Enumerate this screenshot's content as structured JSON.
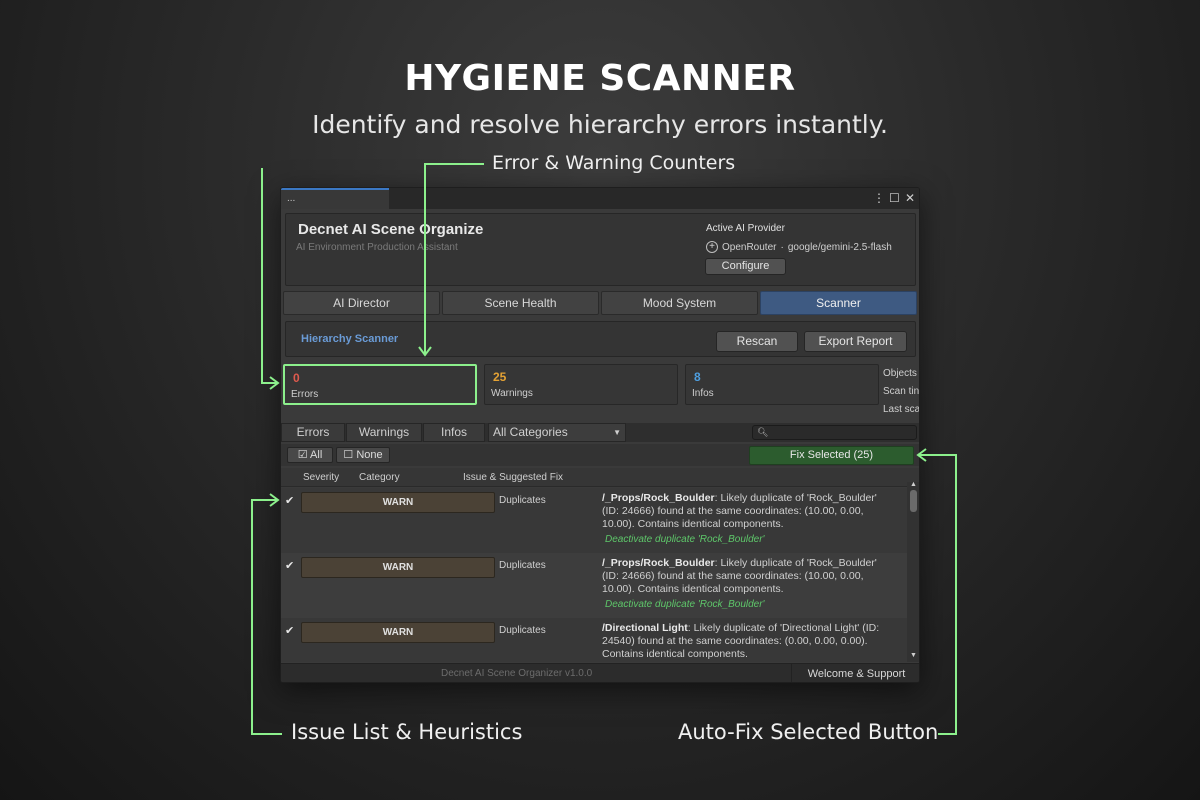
{
  "hero": {
    "title": "HYGIENE SCANNER",
    "subtitle": "Identify and resolve hierarchy errors instantly."
  },
  "callouts": {
    "top": "Error & Warning Counters",
    "bottom_left": "Issue List & Heuristics",
    "bottom_right": "Auto-Fix Selected Button"
  },
  "window": {
    "tab_label": "...",
    "controls": [
      "more-icon",
      "maximize-icon",
      "close-icon"
    ],
    "app_title": "Decnet AI Scene Organize",
    "app_subtitle": "AI Environment Production Assistant",
    "provider_title": "Active AI Provider",
    "provider_name": "OpenRouter",
    "provider_sep": "·",
    "provider_model": "google/gemini-2.5-flash",
    "configure_label": "Configure"
  },
  "main_tabs": [
    "AI Director",
    "Scene Health",
    "Mood System",
    "Scanner"
  ],
  "active_tab": "Scanner",
  "scanner": {
    "title": "Hierarchy Scanner",
    "rescan_label": "Rescan",
    "export_label": "Export Report"
  },
  "counters": {
    "errors": {
      "value": "0",
      "label": "Errors",
      "color": "#e05a4e"
    },
    "warnings": {
      "value": "25",
      "label": "Warnings",
      "color": "#e4a234"
    },
    "infos": {
      "value": "8",
      "label": "Infos",
      "color": "#4e9fe0"
    }
  },
  "stats": [
    "Objects",
    "Scan tin",
    "Last sca"
  ],
  "filters": {
    "tabs": [
      "Errors",
      "Warnings",
      "Infos"
    ],
    "category": "All Categories",
    "all_label": "All",
    "none_label": "None",
    "fix_label": "Fix Selected (25)"
  },
  "columns": {
    "severity": "Severity",
    "category": "Category",
    "issue": "Issue & Suggested Fix"
  },
  "issues": [
    {
      "checked": true,
      "severity": "WARN",
      "category": "Duplicates",
      "path": "/_Props/Rock_Boulder",
      "text": ": Likely duplicate of 'Rock_Boulder' (ID: 24666) found at the same coordinates: (10.00, 0.00, 10.00). Contains identical components.",
      "fix": "Deactivate duplicate 'Rock_Boulder'"
    },
    {
      "checked": true,
      "severity": "WARN",
      "category": "Duplicates",
      "path": "/_Props/Rock_Boulder",
      "text": ": Likely duplicate of 'Rock_Boulder' (ID: 24666) found at the same coordinates: (10.00, 0.00, 10.00). Contains identical components.",
      "fix": "Deactivate duplicate 'Rock_Boulder'"
    },
    {
      "checked": true,
      "severity": "WARN",
      "category": "Duplicates",
      "path": "/Directional Light",
      "text": ": Likely duplicate of 'Directional Light' (ID: 24540) found at the same coordinates: (0.00, 0.00, 0.00). Contains identical components.",
      "fix": ""
    }
  ],
  "footer": {
    "version": "Decnet AI Scene Organizer  v1.0.0",
    "welcome": "Welcome & Support"
  },
  "accent_colors": {
    "callout_line": "#8cf08c",
    "active_tab": "#3e5a82",
    "fix_button": "#2c5c2e",
    "fix_link": "#5ec76a"
  }
}
